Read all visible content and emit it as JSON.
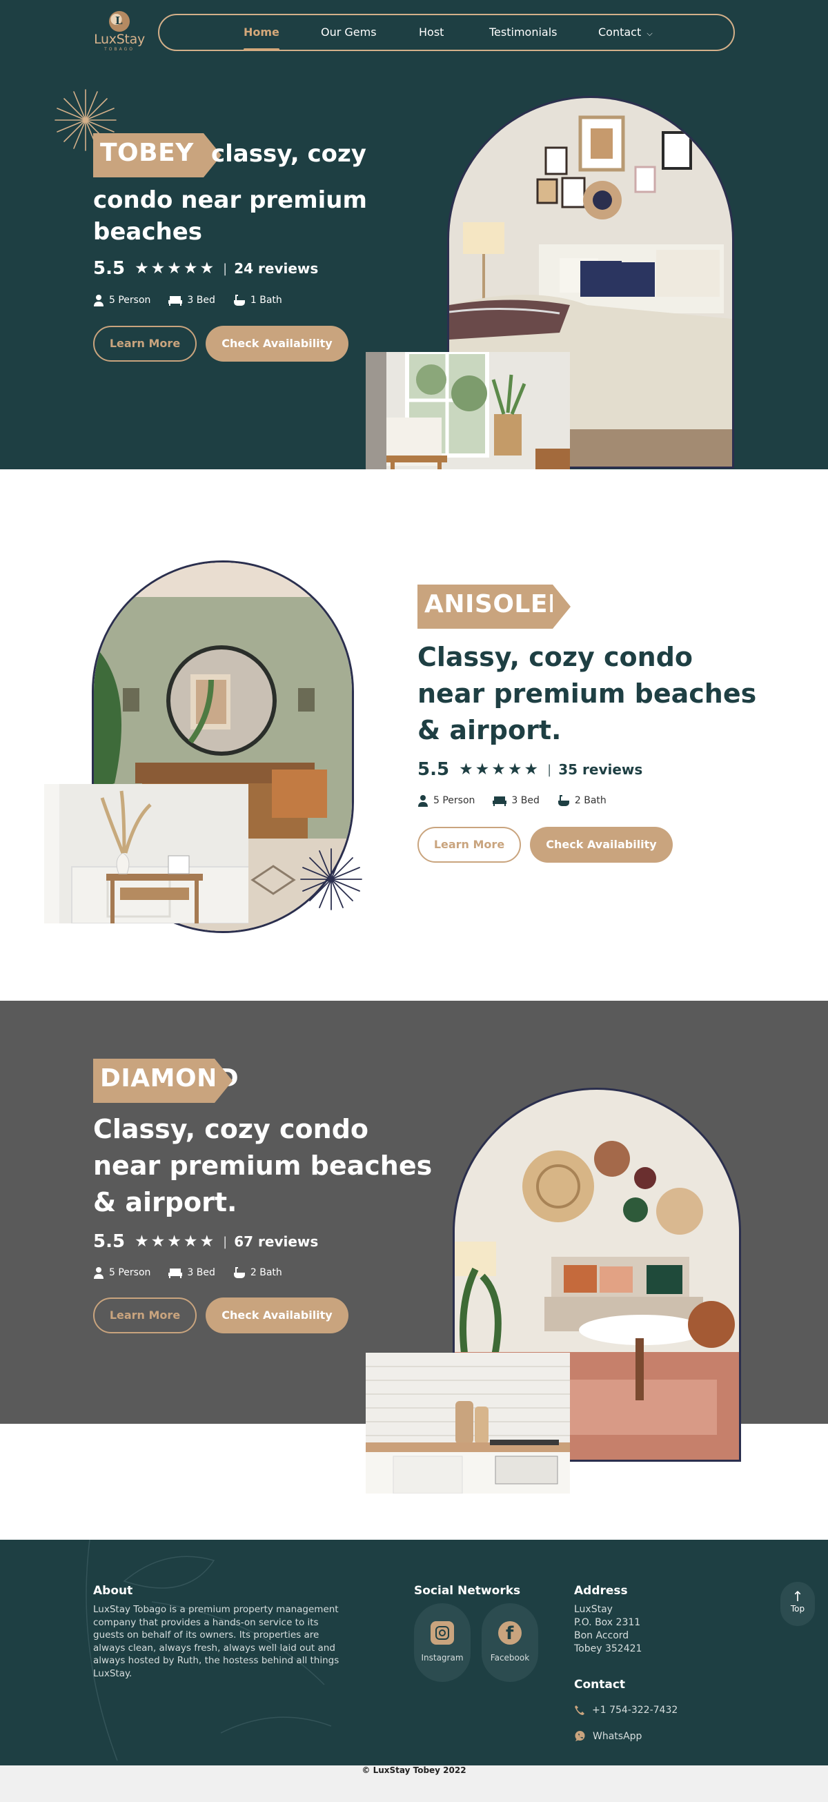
{
  "brand": {
    "logo_letter": "L",
    "name": "LuxStay",
    "sub": "TOBAGO"
  },
  "nav": {
    "items": [
      {
        "label": "Home",
        "active": true
      },
      {
        "label": "Our Gems",
        "active": false
      },
      {
        "label": "Host",
        "active": false
      },
      {
        "label": "Testimonials",
        "active": false
      },
      {
        "label": "Contact",
        "active": false
      }
    ]
  },
  "listings": [
    {
      "tag": "TOBEY",
      "title_inline": "classy, cozy",
      "title_rest_1": "condo near premium",
      "title_rest_2": "beaches",
      "score": "5.5",
      "stars": "★★★★★",
      "sep": "|",
      "reviews": "24 reviews",
      "persons": "5 Person",
      "beds": "3 Bed",
      "baths": "1 Bath",
      "learn": "Learn More",
      "check": "Check Availability"
    },
    {
      "tag": "ANISOLEN",
      "title_1": "Classy, cozy condo",
      "title_2": "near premium beaches",
      "title_3": "& airport.",
      "score": "5.5",
      "stars": "★★★★★",
      "sep": "|",
      "reviews": "35 reviews",
      "persons": "5 Person",
      "beds": "3 Bed",
      "baths": "2 Bath",
      "learn": "Learn More",
      "check": "Check Availability"
    },
    {
      "tag": "DIAMOND",
      "title_1": "Classy, cozy condo",
      "title_2": "near premium beaches",
      "title_3": "& airport.",
      "score": "5.5",
      "stars": "★★★★★",
      "sep": "|",
      "reviews": "67 reviews",
      "persons": "5 Person",
      "beds": "3 Bed",
      "baths": "2 Bath",
      "learn": "Learn More",
      "check": "Check Availability"
    }
  ],
  "footer": {
    "about_title": "About",
    "about_text": "LuxStay Tobago is a premium property management company that provides a hands-on service to its guests on behalf of its owners. Its properties are always clean, always fresh, always well laid out and always hosted by Ruth, the hostess behind all things LuxStay.",
    "social_title": "Social Networks",
    "social": [
      {
        "label": "Instagram"
      },
      {
        "label": "Facebook"
      }
    ],
    "address_title": "Address",
    "address_lines": [
      "LuxStay",
      "P.O. Box 2311",
      "Bon Accord",
      "Tobey 352421"
    ],
    "contact_title": "Contact",
    "phone": "+1 754-322-7432",
    "whatsapp": "WhatsApp",
    "top_label": "Top",
    "copyright": "© LuxStay Tobey 2022"
  },
  "colors": {
    "dark_teal": "#1e3f43",
    "tan": "#c9a47e",
    "grey_section": "#5a5a5a",
    "arch_border": "#2b2f4e"
  }
}
